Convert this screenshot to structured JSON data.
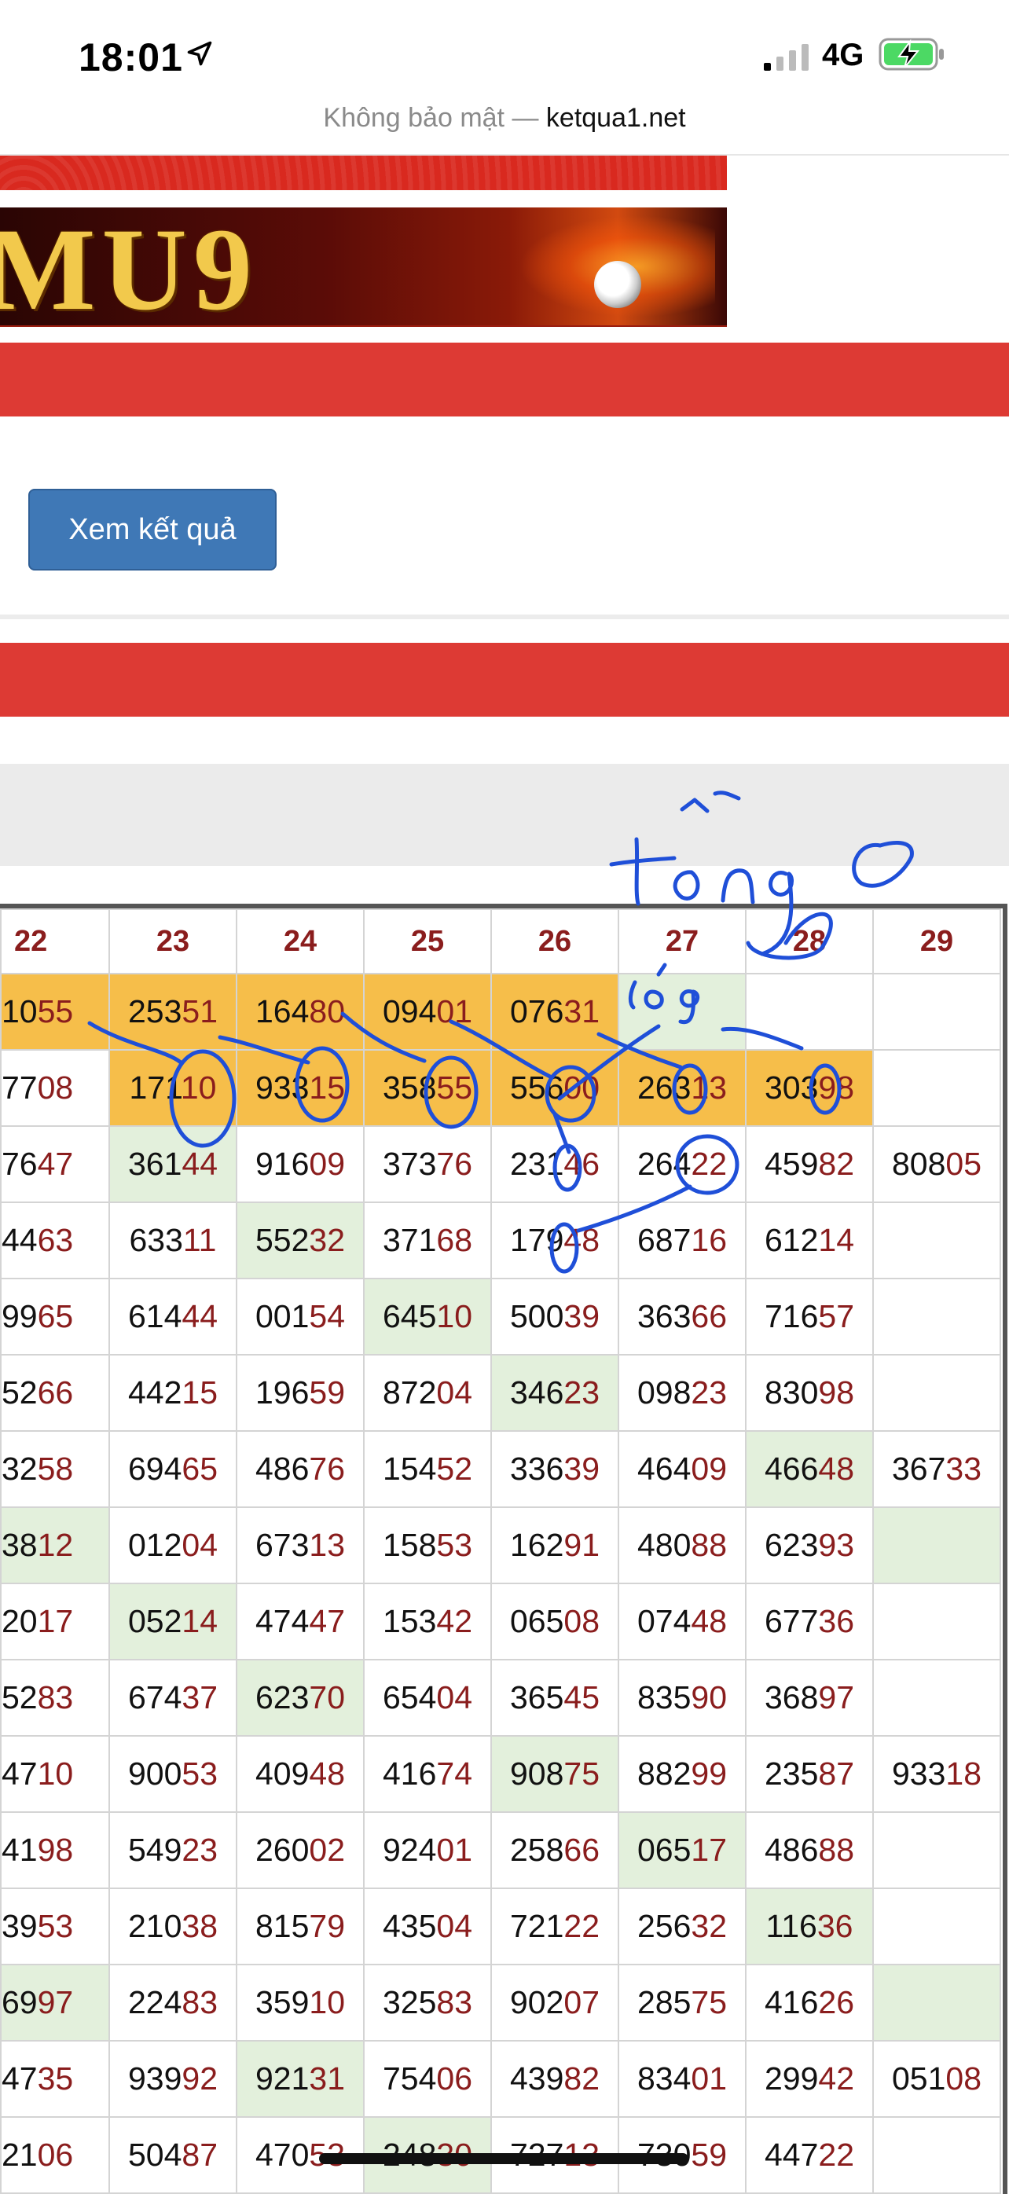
{
  "status": {
    "time": "18:01",
    "network": "4G"
  },
  "browser": {
    "prefix": "Không bảo mật — ",
    "host": "ketqua1.net"
  },
  "banner": {
    "text": "MU9"
  },
  "form": {
    "submit_label": "Xem kết quả"
  },
  "table": {
    "headers": [
      "22",
      "23",
      "24",
      "25",
      "26",
      "27",
      "28",
      "29"
    ],
    "rows": [
      [
        {
          "p": "10",
          "s": "55",
          "c": "y"
        },
        {
          "p": "253",
          "s": "51",
          "c": "y"
        },
        {
          "p": "164",
          "s": "80",
          "c": "y"
        },
        {
          "p": "094",
          "s": "01",
          "c": "y"
        },
        {
          "p": "076",
          "s": "31",
          "c": "y"
        },
        {
          "p": "",
          "s": "",
          "c": "g"
        },
        {
          "p": "",
          "s": "",
          "c": ""
        },
        {
          "p": "",
          "s": "",
          "c": ""
        }
      ],
      [
        {
          "p": "77",
          "s": "08",
          "c": ""
        },
        {
          "p": "171",
          "s": "10",
          "c": "y"
        },
        {
          "p": "933",
          "s": "15",
          "c": "y"
        },
        {
          "p": "358",
          "s": "55",
          "c": "y"
        },
        {
          "p": "556",
          "s": "00",
          "c": "y"
        },
        {
          "p": "263",
          "s": "13",
          "c": "y"
        },
        {
          "p": "303",
          "s": "98",
          "c": "y"
        },
        {
          "p": "",
          "s": "",
          "c": ""
        }
      ],
      [
        {
          "p": "76",
          "s": "47",
          "c": ""
        },
        {
          "p": "361",
          "s": "44",
          "c": "g"
        },
        {
          "p": "916",
          "s": "09",
          "c": ""
        },
        {
          "p": "373",
          "s": "76",
          "c": ""
        },
        {
          "p": "231",
          "s": "46",
          "c": ""
        },
        {
          "p": "264",
          "s": "22",
          "c": ""
        },
        {
          "p": "459",
          "s": "82",
          "c": ""
        },
        {
          "p": "808",
          "s": "05",
          "c": ""
        }
      ],
      [
        {
          "p": "44",
          "s": "63",
          "c": ""
        },
        {
          "p": "633",
          "s": "11",
          "c": ""
        },
        {
          "p": "552",
          "s": "32",
          "c": "g"
        },
        {
          "p": "371",
          "s": "68",
          "c": ""
        },
        {
          "p": "179",
          "s": "48",
          "c": ""
        },
        {
          "p": "687",
          "s": "16",
          "c": ""
        },
        {
          "p": "612",
          "s": "14",
          "c": ""
        },
        {
          "p": "",
          "s": "",
          "c": ""
        }
      ],
      [
        {
          "p": "99",
          "s": "65",
          "c": ""
        },
        {
          "p": "614",
          "s": "44",
          "c": ""
        },
        {
          "p": "001",
          "s": "54",
          "c": ""
        },
        {
          "p": "645",
          "s": "10",
          "c": "g"
        },
        {
          "p": "500",
          "s": "39",
          "c": ""
        },
        {
          "p": "363",
          "s": "66",
          "c": ""
        },
        {
          "p": "716",
          "s": "57",
          "c": ""
        },
        {
          "p": "",
          "s": "",
          "c": ""
        }
      ],
      [
        {
          "p": "52",
          "s": "66",
          "c": ""
        },
        {
          "p": "442",
          "s": "15",
          "c": ""
        },
        {
          "p": "196",
          "s": "59",
          "c": ""
        },
        {
          "p": "872",
          "s": "04",
          "c": ""
        },
        {
          "p": "346",
          "s": "23",
          "c": "g"
        },
        {
          "p": "098",
          "s": "23",
          "c": ""
        },
        {
          "p": "830",
          "s": "98",
          "c": ""
        },
        {
          "p": "",
          "s": "",
          "c": ""
        }
      ],
      [
        {
          "p": "32",
          "s": "58",
          "c": ""
        },
        {
          "p": "694",
          "s": "65",
          "c": ""
        },
        {
          "p": "486",
          "s": "76",
          "c": ""
        },
        {
          "p": "154",
          "s": "52",
          "c": ""
        },
        {
          "p": "336",
          "s": "39",
          "c": ""
        },
        {
          "p": "464",
          "s": "09",
          "c": ""
        },
        {
          "p": "466",
          "s": "48",
          "c": "g"
        },
        {
          "p": "367",
          "s": "33",
          "c": ""
        }
      ],
      [
        {
          "p": "38",
          "s": "12",
          "c": "g"
        },
        {
          "p": "012",
          "s": "04",
          "c": ""
        },
        {
          "p": "673",
          "s": "13",
          "c": ""
        },
        {
          "p": "158",
          "s": "53",
          "c": ""
        },
        {
          "p": "162",
          "s": "91",
          "c": ""
        },
        {
          "p": "480",
          "s": "88",
          "c": ""
        },
        {
          "p": "623",
          "s": "93",
          "c": ""
        },
        {
          "p": "",
          "s": "",
          "c": "g"
        }
      ],
      [
        {
          "p": "20",
          "s": "17",
          "c": ""
        },
        {
          "p": "052",
          "s": "14",
          "c": "g"
        },
        {
          "p": "474",
          "s": "47",
          "c": ""
        },
        {
          "p": "153",
          "s": "42",
          "c": ""
        },
        {
          "p": "065",
          "s": "08",
          "c": ""
        },
        {
          "p": "074",
          "s": "48",
          "c": ""
        },
        {
          "p": "677",
          "s": "36",
          "c": ""
        },
        {
          "p": "",
          "s": "",
          "c": ""
        }
      ],
      [
        {
          "p": "52",
          "s": "83",
          "c": ""
        },
        {
          "p": "674",
          "s": "37",
          "c": ""
        },
        {
          "p": "623",
          "s": "70",
          "c": "g"
        },
        {
          "p": "654",
          "s": "04",
          "c": ""
        },
        {
          "p": "365",
          "s": "45",
          "c": ""
        },
        {
          "p": "835",
          "s": "90",
          "c": ""
        },
        {
          "p": "368",
          "s": "97",
          "c": ""
        },
        {
          "p": "",
          "s": "",
          "c": ""
        }
      ],
      [
        {
          "p": "47",
          "s": "10",
          "c": ""
        },
        {
          "p": "900",
          "s": "53",
          "c": ""
        },
        {
          "p": "409",
          "s": "48",
          "c": ""
        },
        {
          "p": "416",
          "s": "74",
          "c": ""
        },
        {
          "p": "908",
          "s": "75",
          "c": "g"
        },
        {
          "p": "882",
          "s": "99",
          "c": ""
        },
        {
          "p": "235",
          "s": "87",
          "c": ""
        },
        {
          "p": "933",
          "s": "18",
          "c": ""
        }
      ],
      [
        {
          "p": "41",
          "s": "98",
          "c": ""
        },
        {
          "p": "549",
          "s": "23",
          "c": ""
        },
        {
          "p": "260",
          "s": "02",
          "c": ""
        },
        {
          "p": "924",
          "s": "01",
          "c": ""
        },
        {
          "p": "258",
          "s": "66",
          "c": ""
        },
        {
          "p": "065",
          "s": "17",
          "c": "g"
        },
        {
          "p": "486",
          "s": "88",
          "c": ""
        },
        {
          "p": "",
          "s": "",
          "c": ""
        }
      ],
      [
        {
          "p": "39",
          "s": "53",
          "c": ""
        },
        {
          "p": "210",
          "s": "38",
          "c": ""
        },
        {
          "p": "815",
          "s": "79",
          "c": ""
        },
        {
          "p": "435",
          "s": "04",
          "c": ""
        },
        {
          "p": "721",
          "s": "22",
          "c": ""
        },
        {
          "p": "256",
          "s": "32",
          "c": ""
        },
        {
          "p": "116",
          "s": "36",
          "c": "g"
        },
        {
          "p": "",
          "s": "",
          "c": ""
        }
      ],
      [
        {
          "p": "69",
          "s": "97",
          "c": "g"
        },
        {
          "p": "224",
          "s": "83",
          "c": ""
        },
        {
          "p": "359",
          "s": "10",
          "c": ""
        },
        {
          "p": "325",
          "s": "83",
          "c": ""
        },
        {
          "p": "902",
          "s": "07",
          "c": ""
        },
        {
          "p": "285",
          "s": "75",
          "c": ""
        },
        {
          "p": "416",
          "s": "26",
          "c": ""
        },
        {
          "p": "",
          "s": "",
          "c": "g"
        }
      ],
      [
        {
          "p": "47",
          "s": "35",
          "c": ""
        },
        {
          "p": "939",
          "s": "92",
          "c": ""
        },
        {
          "p": "921",
          "s": "31",
          "c": "g"
        },
        {
          "p": "754",
          "s": "06",
          "c": ""
        },
        {
          "p": "439",
          "s": "82",
          "c": ""
        },
        {
          "p": "834",
          "s": "01",
          "c": ""
        },
        {
          "p": "299",
          "s": "42",
          "c": ""
        },
        {
          "p": "051",
          "s": "08",
          "c": ""
        }
      ],
      [
        {
          "p": "21",
          "s": "06",
          "c": ""
        },
        {
          "p": "504",
          "s": "87",
          "c": ""
        },
        {
          "p": "470",
          "s": "53",
          "c": ""
        },
        {
          "p": "248",
          "s": "30",
          "c": "g"
        },
        {
          "p": "727",
          "s": "13",
          "c": ""
        },
        {
          "p": "730",
          "s": "59",
          "c": ""
        },
        {
          "p": "447",
          "s": "22",
          "c": ""
        },
        {
          "p": "",
          "s": "",
          "c": ""
        }
      ]
    ]
  },
  "colors": {
    "header_red": "#dd3a34",
    "button_blue": "#3f78b6",
    "yellow_cell": "#f6be4a",
    "green_cell": "#e3f0dc",
    "number_red": "#8a1d1d",
    "ink_blue": "#1f4fd8"
  },
  "annotations": {
    "note": "tổng 0",
    "note2": "lóg"
  }
}
